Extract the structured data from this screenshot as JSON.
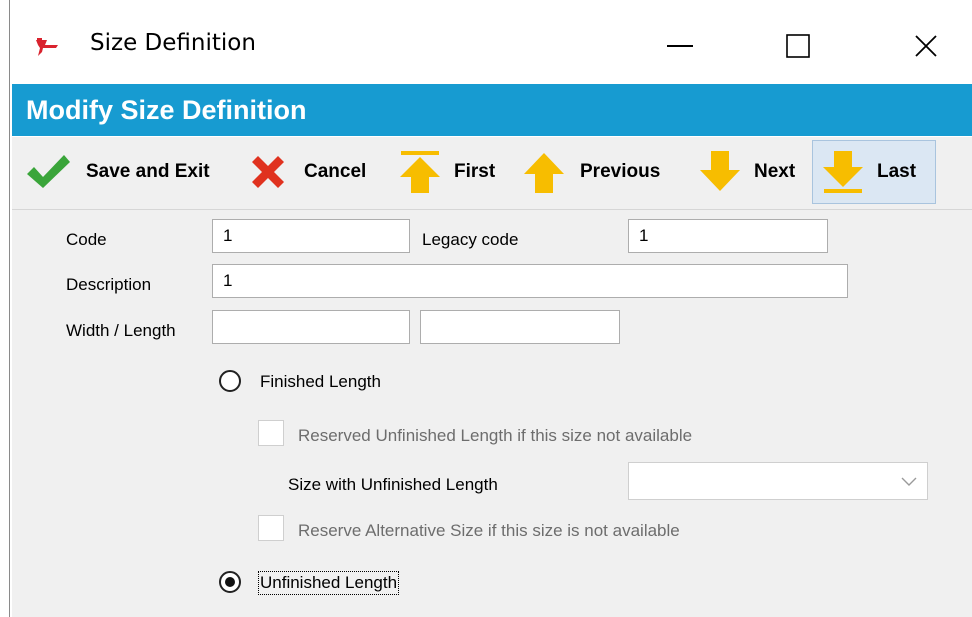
{
  "window": {
    "title": "Size Definition",
    "icon": "red-trolley-icon"
  },
  "banner": {
    "title": "Modify Size Definition",
    "color": "#179bd1"
  },
  "toolbar": {
    "save_label": "Save and Exit",
    "cancel_label": "Cancel",
    "first_label": "First",
    "previous_label": "Previous",
    "next_label": "Next",
    "last_label": "Last"
  },
  "form": {
    "code_label": "Code",
    "code_value": "1",
    "legacy_code_label": "Legacy code",
    "legacy_code_value": "1",
    "description_label": "Description",
    "description_value": "1",
    "width_length_label": "Width / Length",
    "width_value": "",
    "length_value": "",
    "finished_length_label": "Finished Length",
    "finished_length_selected": false,
    "reserved_unfinished_label": "Reserved Unfinished Length if this size not available",
    "reserved_unfinished_checked": false,
    "size_unfinished_label": "Size with Unfinished Length",
    "size_unfinished_value": "",
    "reserve_alternative_label": "Reserve Alternative Size if this size is not available",
    "reserve_alternative_checked": false,
    "unfinished_length_label": "Unfinished Length",
    "unfinished_length_selected": true
  },
  "colors": {
    "accent": "#179bd1",
    "save_check": "#3aa53a",
    "cancel_x": "#e0321f",
    "arrow": "#f7bd00"
  }
}
